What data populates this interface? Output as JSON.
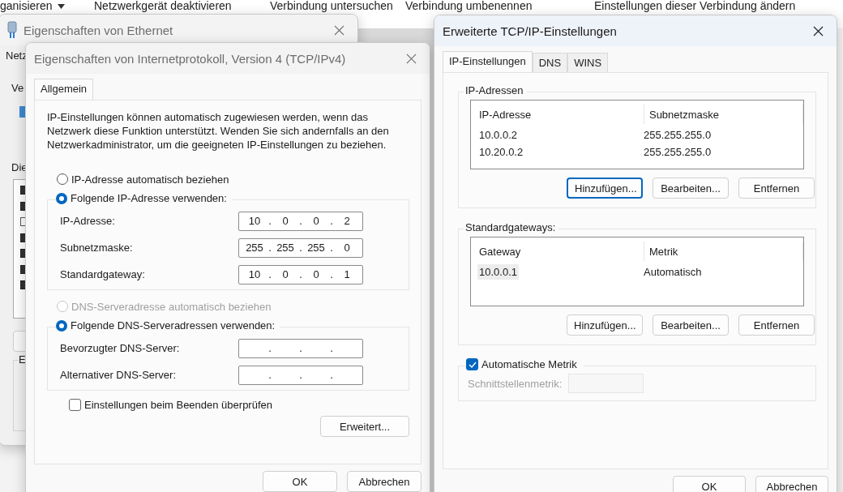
{
  "toolbar": [
    {
      "label": "ganisieren",
      "caret": true
    },
    {
      "label": "Netzwerkgerät deaktivieren",
      "caret": false
    },
    {
      "label": "Verbindung untersuchen",
      "caret": false
    },
    {
      "label": "Verbindung umbenennen",
      "caret": false
    },
    {
      "label": "Einstellungen dieser Verbindung ändern",
      "caret": false
    }
  ],
  "ethernet_window": {
    "title": "Eigenschaften von Ethernet",
    "tab": "Netz",
    "connect_label": "Ve",
    "list_label": "Die",
    "components": [
      {
        "checked": true
      },
      {
        "checked": true
      },
      {
        "checked": false
      },
      {
        "checked": true
      },
      {
        "checked": true
      },
      {
        "checked": true
      },
      {
        "checked": true
      }
    ],
    "group_label": "E"
  },
  "ipv4_dialog": {
    "title": "Eigenschaften von Internetprotokoll, Version 4 (TCP/IPv4)",
    "tabs": [
      {
        "label": "Allgemein",
        "selected": true
      }
    ],
    "description": "IP-Einstellungen können automatisch zugewiesen werden, wenn das Netzwerk diese Funktion unterstützt. Wenden Sie sich andernfalls an den Netzwerkadministrator, um die geeigneten IP-Einstellungen zu beziehen.",
    "ip_auto": {
      "label": "IP-Adresse automatisch beziehen",
      "selected": false,
      "disabled": false
    },
    "ip_manual": {
      "label": "Folgende IP-Adresse verwenden:",
      "selected": true,
      "disabled": false
    },
    "separator": ".",
    "ip_fields": [
      {
        "label": "IP-Adresse:",
        "octets": [
          "10",
          "0",
          "0",
          "2"
        ]
      },
      {
        "label": "Subnetzmaske:",
        "octets": [
          "255",
          "255",
          "255",
          "0"
        ]
      },
      {
        "label": "Standardgateway:",
        "octets": [
          "10",
          "0",
          "0",
          "1"
        ]
      }
    ],
    "dns_auto": {
      "label": "DNS-Serveradresse automatisch beziehen",
      "selected": false,
      "disabled": true
    },
    "dns_manual": {
      "label": "Folgende DNS-Serveradressen verwenden:",
      "selected": true,
      "disabled": false
    },
    "dns_fields": [
      {
        "label": "Bevorzugter DNS-Server:"
      },
      {
        "label": "Alternativer DNS-Server:"
      }
    ],
    "validate": {
      "label": "Einstellungen beim Beenden überprüfen",
      "checked": false
    },
    "advanced_button": "Erweitert...",
    "buttons": [
      "OK",
      "Abbrechen"
    ]
  },
  "advanced_dialog": {
    "title": "Erweiterte TCP/IP-Einstellungen",
    "tabs": [
      {
        "label": "IP-Einstellungen",
        "selected": true
      },
      {
        "label": "DNS",
        "selected": false
      },
      {
        "label": "WINS",
        "selected": false
      }
    ],
    "ip_group": {
      "title": "IP-Adressen",
      "columns": [
        "IP-Adresse",
        "Subnetzmaske"
      ],
      "rows": [
        {
          "cells": [
            "10.0.0.2",
            "255.255.255.0"
          ],
          "selected": false
        },
        {
          "cells": [
            "10.20.0.2",
            "255.255.255.0"
          ],
          "selected": false
        }
      ],
      "buttons": [
        {
          "label": "Hinzufügen...",
          "focused": true
        },
        {
          "label": "Bearbeiten...",
          "focused": false
        },
        {
          "label": "Entfernen",
          "focused": false
        }
      ]
    },
    "gateway_group": {
      "title": "Standardgateways:",
      "columns": [
        "Gateway",
        "Metrik"
      ],
      "rows": [
        {
          "cells": [
            "10.0.0.1",
            "Automatisch"
          ],
          "selected": true
        }
      ],
      "buttons": [
        {
          "label": "Hinzufügen...",
          "focused": false
        },
        {
          "label": "Bearbeiten...",
          "focused": false
        },
        {
          "label": "Entfernen",
          "focused": false
        }
      ]
    },
    "auto_metric": {
      "label": "Automatische Metrik",
      "checked": true
    },
    "interface_metric": {
      "label": "Schnittstellenmetrik:",
      "disabled": true
    },
    "buttons": [
      "OK",
      "Abbrechen"
    ]
  }
}
